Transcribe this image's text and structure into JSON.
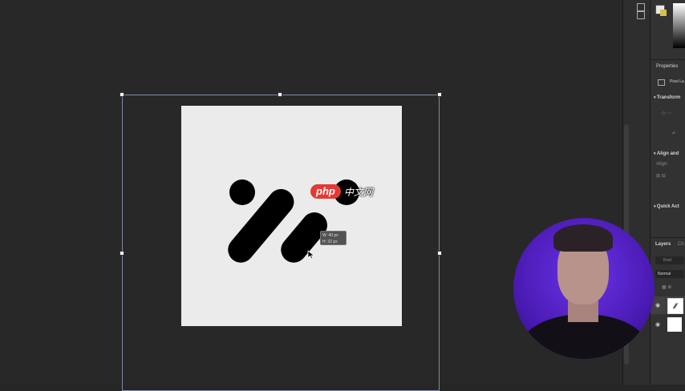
{
  "canvas": {
    "watermark_pill": "php",
    "watermark_text": "中文网",
    "tooltip_line1": "W: 40 px",
    "tooltip_line2": "H: 32 px"
  },
  "panel": {
    "properties_title": "Properties",
    "pixel_layer_label": "Pixel La",
    "transform_title": "Transform",
    "align_section_title": "Align and",
    "align_label": "Align:",
    "quick_actions_title": "Quick Act",
    "layers_tab": "Layers",
    "channels_tab": "Ch",
    "kind_filter": "Kind",
    "blend_mode": "Normal"
  },
  "colors": {
    "canvas_bg": "#282828",
    "artboard": "#ebebeb",
    "accent_watermark": "#e53935",
    "webcam_bg": "#5a24d9"
  },
  "icons": [
    "eye-icon",
    "chevron-icon",
    "color-swatch-icon"
  ]
}
